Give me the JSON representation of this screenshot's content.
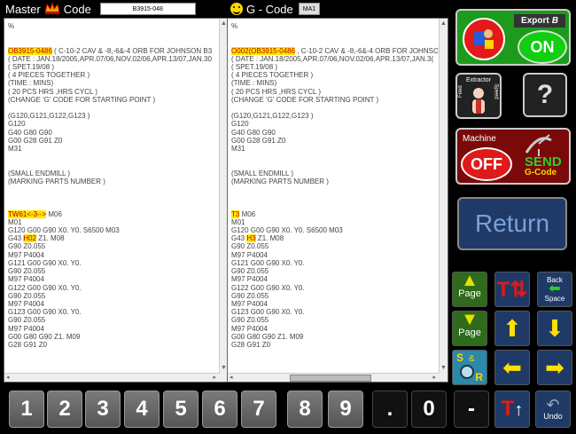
{
  "header": {
    "master_label": "Master",
    "code_label": "Code",
    "master_code_value": "B3915-048",
    "gcode_label": "G - Code",
    "gcode_value": "MA1"
  },
  "left_panel": {
    "lines": [
      "%",
      "",
      "",
      "OB3915-0486 ( C-10-2 CAV & -8,-6&-4 ORB FOR JOHNSON B3",
      "( DATE : JAN.18/2005,APR.07/06,NOV.02/06,APR.13/07,JAN.30",
      "( SPET.19/08 )",
      "( 4 PIECES TOGETHER )",
      "(TIME : MINS)",
      "( 20 PCS HRS ,HRS CYCL )",
      "(CHANGE 'G' CODE FOR STARTING POINT )",
      "",
      "(G120,G121,G122,G123 )",
      "G120",
      "G40 G80 G90",
      "G00 G28 G91 Z0",
      "M31",
      "",
      "",
      "(SMALL ENDMILL )",
      "(MARKING PARTS NUMBER )",
      "",
      "",
      "",
      "TW61<-3--> M06",
      "M01",
      "G120 G00 G90 X0. Y0. S6500 M03",
      "G43 H02 Z1. M08",
      "G90 Z0.055",
      "M97 P4004",
      "G121 G00 G90 X0. Y0.",
      "G90 Z0.055",
      "M97 P4004",
      "G122 G00 G90 X0. Y0.",
      "G90 Z0.055",
      "M97 P4004",
      "G123 G00 G90 X0. Y0.",
      "G90 Z0.055",
      "M97 P4004",
      "G00 G80 G90 Z1. M09",
      "G28 G91 Z0"
    ],
    "highlights": [
      "OB3915-0486",
      "TW61<-3-->",
      "H02"
    ]
  },
  "right_panel": {
    "lines": [
      "%",
      "",
      "",
      "O002(OB3915-0486 , C-10-2 CAV & -8,-6&-4 ORB FOR JOHNSC",
      "( DATE : JAN.18/2005,APR.07/06,NOV.02/06,APR.13/07,JAN.3(",
      "( SPET.19/08 )",
      "( 4 PIECES TOGETHER )",
      "(TIME : MINS)",
      "( 20 PCS HRS ,HRS CYCL )",
      "(CHANGE 'G' CODE FOR STARTING POINT )",
      "",
      "(G120,G121,G122,G123 )",
      "G120",
      "G40 G80 G90",
      "G00 G28 G91 Z0",
      "M31",
      "",
      "",
      "(SMALL ENDMILL )",
      "(MARKING PARTS NUMBER )",
      "",
      "",
      "",
      "T3 M06",
      "M01",
      "G120 G00 G90 X0. Y0. S6500 M03",
      "G43 H3 Z1. M08",
      "G90 Z0.055",
      "M97 P4004",
      "G121 G00 G90 X0. Y0.",
      "G90 Z0.055",
      "M97 P4004",
      "G122 G00 G90 X0. Y0.",
      "G90 Z0.055",
      "M97 P4004",
      "G123 G00 G90 X0. Y0.",
      "G90 Z0.055",
      "M97 P4004",
      "G00 G80 G90 Z1. M09",
      "G28 G91 Z0"
    ],
    "highlights": [
      "O002(OB3915-0486",
      "T3",
      "H3"
    ]
  },
  "side": {
    "export_label": "Export",
    "export_state": "ON",
    "extractor_label": "Extractor",
    "feed_label": "Feed",
    "speed_label": "Speed",
    "help_label": "?",
    "machine_label": "Machine",
    "machine_state": "OFF",
    "send_label": "SEND",
    "send_sub_label": "G-Code",
    "return_label": "Return",
    "page_up_label": "Page",
    "page_down_label": "Page",
    "backspace_label1": "Back",
    "backspace_label2": "Space",
    "search_s": "S",
    "search_amp": "&",
    "search_r": "R"
  },
  "keypad": {
    "digits": [
      "1",
      "2",
      "3",
      "4",
      "5",
      "6",
      "7",
      "8",
      "9"
    ],
    "dot": ".",
    "zero": "0",
    "minus": "-",
    "undo_label": "Undo"
  },
  "colors": {
    "highlight": "#ffe600",
    "accent_green": "#1a8f1a",
    "accent_red": "#d01010",
    "return_blue": "#1f3a66"
  }
}
